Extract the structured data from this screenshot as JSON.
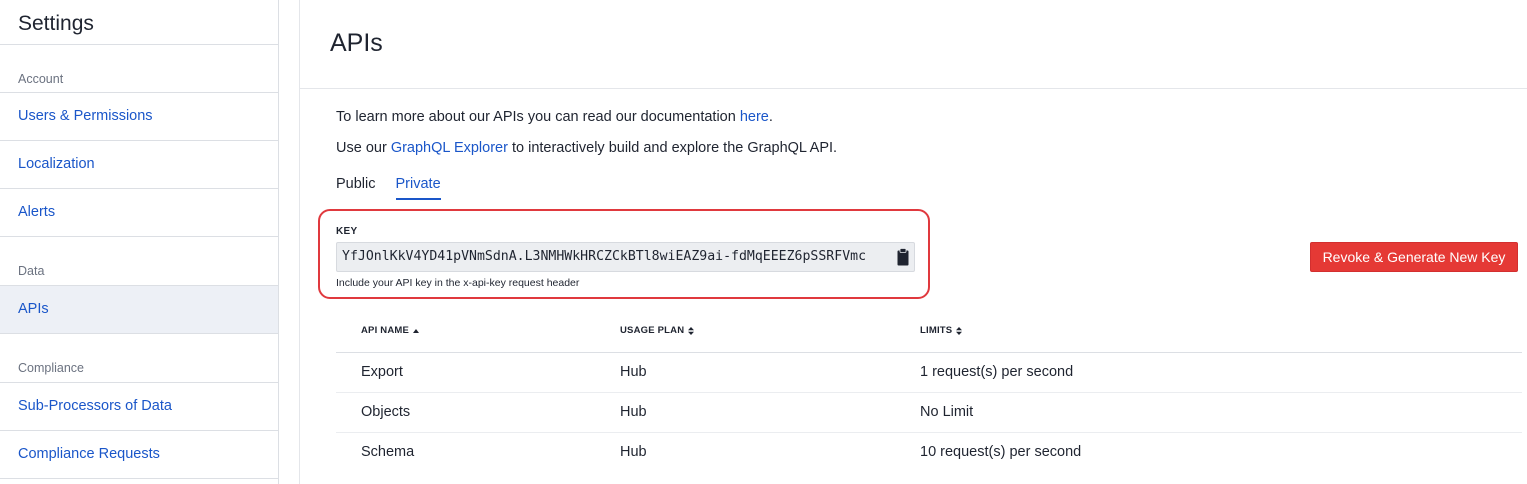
{
  "sidebar": {
    "title": "Settings",
    "sections": [
      {
        "label": "Account"
      },
      {
        "label": "Data"
      },
      {
        "label": "Compliance"
      }
    ],
    "items": [
      {
        "label": "Users & Permissions"
      },
      {
        "label": "Localization"
      },
      {
        "label": "Alerts"
      },
      {
        "label": "APIs",
        "active": true
      },
      {
        "label": "Sub-Processors of Data"
      },
      {
        "label": "Compliance Requests"
      }
    ]
  },
  "main": {
    "title": "APIs",
    "intro1": {
      "prefix": "To learn more about our APIs you can read our documentation ",
      "link": "here",
      "suffix": "."
    },
    "intro2": {
      "prefix": "Use our ",
      "link": "GraphQL Explorer",
      "suffix": " to interactively build and explore the GraphQL API."
    },
    "tabs": [
      {
        "label": "Public",
        "active": false
      },
      {
        "label": "Private",
        "active": true
      }
    ],
    "key": {
      "label": "KEY",
      "value": "YfJOnlKkV4YD41pVNmSdnA.L3NMHWkHRCZCkBTl8wiEAZ9ai-fdMqEEEZ6pSSRFVmc",
      "hint": "Include your API key in the x-api-key request header"
    },
    "revoke_button": "Revoke & Generate New Key",
    "accent_color": "#1a56c9",
    "danger_color": "#e53935"
  },
  "table": {
    "headers": [
      "API NAME",
      "USAGE PLAN",
      "LIMITS"
    ],
    "rows": [
      {
        "name": "Export",
        "plan": "Hub",
        "limit": "1 request(s) per second"
      },
      {
        "name": "Objects",
        "plan": "Hub",
        "limit": "No Limit"
      },
      {
        "name": "Schema",
        "plan": "Hub",
        "limit": "10 request(s) per second"
      }
    ]
  }
}
